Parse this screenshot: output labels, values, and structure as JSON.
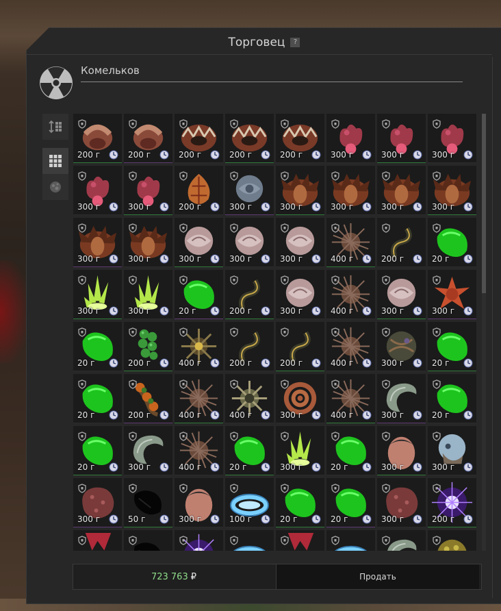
{
  "window": {
    "title": "Торговец",
    "help_label": "?"
  },
  "trader": {
    "name": "Комельков",
    "icon": "radiation-icon"
  },
  "sidebar": {
    "buttons": [
      {
        "name": "sort-button",
        "icon": "sort-icon",
        "active": false
      },
      {
        "name": "grid-view-button",
        "icon": "grid-icon",
        "active": true
      },
      {
        "name": "artifact-filter-button",
        "icon": "artifact-icon",
        "active": false
      }
    ]
  },
  "items": [
    {
      "price": "200 г",
      "art": "claw"
    },
    {
      "price": "200 г",
      "art": "claw"
    },
    {
      "price": "200 г",
      "art": "jaw"
    },
    {
      "price": "200 г",
      "art": "jaw"
    },
    {
      "price": "200 г",
      "art": "jaw"
    },
    {
      "price": "300 г",
      "art": "coral"
    },
    {
      "price": "300 г",
      "art": "coral"
    },
    {
      "price": "300 г",
      "art": "coral"
    },
    {
      "price": "300 г",
      "art": "coral"
    },
    {
      "price": "300 г",
      "art": "coral"
    },
    {
      "price": "200 г",
      "art": "seed"
    },
    {
      "price": "300 г",
      "art": "rose-blue"
    },
    {
      "price": "300 г",
      "art": "pod"
    },
    {
      "price": "300 г",
      "art": "pod"
    },
    {
      "price": "300 г",
      "art": "pod"
    },
    {
      "price": "300 г",
      "art": "pod"
    },
    {
      "price": "300 г",
      "art": "pod"
    },
    {
      "price": "300 г",
      "art": "pod"
    },
    {
      "price": "300 г",
      "art": "rose"
    },
    {
      "price": "300 г",
      "art": "rose"
    },
    {
      "price": "300 г",
      "art": "rose"
    },
    {
      "price": "400 г",
      "art": "spiky"
    },
    {
      "price": "200 г",
      "art": "tendril"
    },
    {
      "price": "20 г",
      "art": "green"
    },
    {
      "price": "300 г",
      "art": "crystal"
    },
    {
      "price": "300 г",
      "art": "crystal"
    },
    {
      "price": "20 г",
      "art": "green"
    },
    {
      "price": "200 г",
      "art": "tendril"
    },
    {
      "price": "300 г",
      "art": "rose"
    },
    {
      "price": "400 г",
      "art": "spiky"
    },
    {
      "price": "300 г",
      "art": "rose"
    },
    {
      "price": "300 г",
      "art": "star"
    },
    {
      "price": "20 г",
      "art": "green"
    },
    {
      "price": "200 г",
      "art": "berries"
    },
    {
      "price": "400 г",
      "art": "mine"
    },
    {
      "price": "200 г",
      "art": "tendril"
    },
    {
      "price": "200 г",
      "art": "tendril"
    },
    {
      "price": "400 г",
      "art": "spiky"
    },
    {
      "price": "300 г",
      "art": "sphere"
    },
    {
      "price": "20 г",
      "art": "green"
    },
    {
      "price": "20 г",
      "art": "green"
    },
    {
      "price": "200 г",
      "art": "berries-orange"
    },
    {
      "price": "400 г",
      "art": "spiky"
    },
    {
      "price": "400 г",
      "art": "mine-gold"
    },
    {
      "price": "300 г",
      "art": "coil"
    },
    {
      "price": "400 г",
      "art": "spiky"
    },
    {
      "price": "300 г",
      "art": "shell"
    },
    {
      "price": "20 г",
      "art": "green"
    },
    {
      "price": "20 г",
      "art": "green"
    },
    {
      "price": "300 г",
      "art": "shell"
    },
    {
      "price": "400 г",
      "art": "spiky"
    },
    {
      "price": "20 г",
      "art": "green"
    },
    {
      "price": "300 г",
      "art": "crystal"
    },
    {
      "price": "20 г",
      "art": "green"
    },
    {
      "price": "300 г",
      "art": "egg"
    },
    {
      "price": "300 г",
      "art": "skull"
    },
    {
      "price": "300 г",
      "art": "rock"
    },
    {
      "price": "50 г",
      "art": "black"
    },
    {
      "price": "300 г",
      "art": "egg"
    },
    {
      "price": "100 г",
      "art": "ring"
    },
    {
      "price": "20 г",
      "art": "green"
    },
    {
      "price": "20 г",
      "art": "green"
    },
    {
      "price": "300 г",
      "art": "rock"
    },
    {
      "price": "200 г",
      "art": "plasma"
    },
    {
      "price": "",
      "art": "partial-red"
    },
    {
      "price": "",
      "art": "black"
    },
    {
      "price": "",
      "art": "plasma"
    },
    {
      "price": "",
      "art": "ring"
    },
    {
      "price": "",
      "art": "partial-red"
    },
    {
      "price": "",
      "art": "ring"
    },
    {
      "price": "",
      "art": "shell"
    },
    {
      "price": "",
      "art": "sphere-gold"
    }
  ],
  "footer": {
    "money": "723 763",
    "currency": "₽",
    "sell_label": "Продать"
  },
  "colors": {
    "accent_money": "#8fdc8a",
    "panel": "#272727",
    "cell": "#1b1b1b"
  }
}
